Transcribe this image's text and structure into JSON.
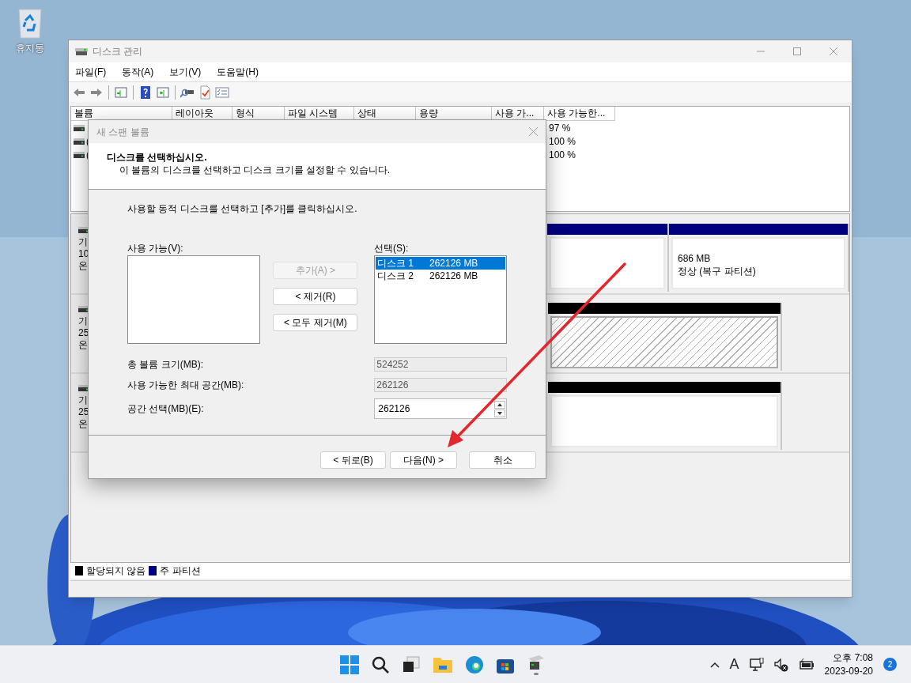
{
  "desktop": {
    "icons": [
      {
        "label": "휴지통"
      }
    ]
  },
  "window": {
    "title": "디스크 관리",
    "menu": [
      "파일(F)",
      "동작(A)",
      "보기(V)",
      "도움말(H)"
    ],
    "volume_table": {
      "columns": [
        "볼륨",
        "레이아웃",
        "형식",
        "파일 시스템",
        "상태",
        "용량",
        "사용 가...",
        "사용 가능한..."
      ],
      "rows": [
        {
          "percent": "97 %"
        },
        {
          "volume": "(",
          "percent": "100 %"
        },
        {
          "volume": "(",
          "percent": "100 %"
        }
      ]
    },
    "disks": [
      {
        "lines": [
          "기",
          "10",
          "온"
        ],
        "partitions": [
          {
            "kind": "primary",
            "selected": false
          },
          {
            "kind": "primary",
            "selected": false,
            "size": "686 MB",
            "status": "정상 (복구 파티션)"
          }
        ]
      },
      {
        "lines": [
          "기",
          "25",
          "온"
        ],
        "partitions": [
          {
            "kind": "unallocated",
            "selected": true
          }
        ]
      },
      {
        "lines": [
          "기",
          "25",
          "온"
        ],
        "partitions": [
          {
            "kind": "unallocated",
            "selected": false
          }
        ]
      }
    ],
    "legend": [
      {
        "label": "할당되지 않음",
        "color": "#000000"
      },
      {
        "label": "주 파티션",
        "color": "#000080"
      }
    ]
  },
  "dialog": {
    "title": "새 스팬 볼륨",
    "heading": "디스크를 선택하십시오.",
    "subheading": "이 볼륨의 디스크를 선택하고 디스크 크기를 설정할 수 있습니다.",
    "instruction": "사용할 동적 디스크를 선택하고 [추가]를 클릭하십시오.",
    "available_label": "사용 가능(V):",
    "selected_label": "선택(S):",
    "selected_items": [
      {
        "disk": "디스크 1",
        "size": "262126 MB",
        "selected": true
      },
      {
        "disk": "디스크 2",
        "size": "262126 MB",
        "selected": false
      }
    ],
    "move_buttons": [
      {
        "label": "추가(A) >",
        "disabled": true
      },
      {
        "label": "< 제거(R)",
        "disabled": false
      },
      {
        "label": "< 모두 제거(M)",
        "disabled": false
      }
    ],
    "fields": [
      {
        "label": "총 볼륨 크기(MB):",
        "value": "524252",
        "kind": "readonly"
      },
      {
        "label": "사용 가능한 최대 공간(MB):",
        "value": "262126",
        "kind": "readonly"
      },
      {
        "label": "공간 선택(MB)(E):",
        "value": "262126",
        "kind": "spinner"
      }
    ],
    "buttons": [
      "< 뒤로(B)",
      "다음(N) >",
      "취소"
    ]
  },
  "taskbar": {
    "ime": "A",
    "time": "오후 7:08",
    "date": "2023-09-20",
    "notifications": "2"
  }
}
